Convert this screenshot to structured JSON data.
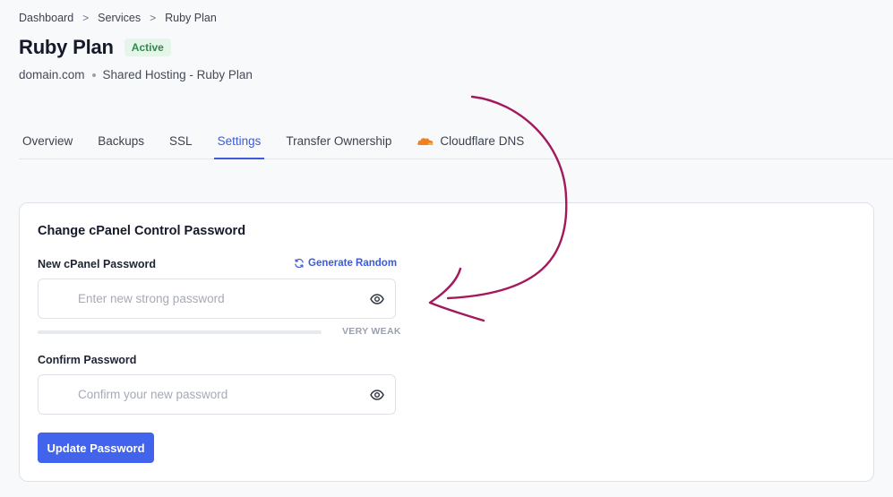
{
  "breadcrumb": {
    "items": [
      "Dashboard",
      "Services",
      "Ruby Plan"
    ],
    "separator": ">"
  },
  "header": {
    "title": "Ruby Plan",
    "status": "Active",
    "domain": "domain.com",
    "plan": "Shared Hosting - Ruby Plan"
  },
  "tabs": [
    {
      "label": "Overview"
    },
    {
      "label": "Backups"
    },
    {
      "label": "SSL"
    },
    {
      "label": "Settings",
      "active": true
    },
    {
      "label": "Transfer Ownership"
    },
    {
      "label": "Cloudflare DNS",
      "icon": "cloud-icon"
    }
  ],
  "card": {
    "title": "Change cPanel Control Password",
    "new_password": {
      "label": "New cPanel Password",
      "generate_label": "Generate Random",
      "placeholder": "Enter new strong password",
      "value": "",
      "strength_label": "VERY WEAK",
      "strength_fraction": 0
    },
    "confirm_password": {
      "label": "Confirm Password",
      "placeholder": "Confirm your new password",
      "value": ""
    },
    "submit_label": "Update Password"
  },
  "colors": {
    "accent": "#4263eb",
    "active_tab": "#3b5bdb",
    "status_bg": "#e5f5ea",
    "status_text": "#2e8a4a",
    "cloudflare": "#f38020",
    "annotation": "#a3195b"
  }
}
